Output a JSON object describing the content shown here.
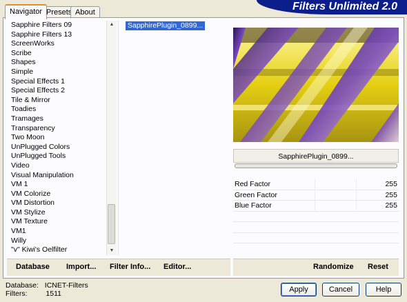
{
  "tabs": [
    "Navigator",
    "Presets",
    "About"
  ],
  "banner": "Filters Unlimited 2.0",
  "categories": [
    "Sapphire Filters 09",
    "Sapphire Filters 13",
    "ScreenWorks",
    "Scribe",
    "Shapes",
    "Simple",
    "Special Effects 1",
    "Special Effects 2",
    "Tile & Mirror",
    "Toadies",
    "Tramages",
    "Transparency",
    "Two Moon",
    "UnPlugged Colors",
    "UnPlugged Tools",
    "Video",
    "Visual Manipulation",
    "VM 1",
    "VM Colorize",
    "VM Distortion",
    "VM Stylize",
    "VM Texture",
    "VM1",
    "Willy",
    "\"v\" Kiwi's Oelfilter"
  ],
  "filters": [
    "SapphirePlugin_0899..."
  ],
  "selected_filter": "SapphirePlugin_0899...",
  "params": [
    {
      "label": "Red Factor",
      "value": "255"
    },
    {
      "label": "Green Factor",
      "value": "255"
    },
    {
      "label": "Blue Factor",
      "value": "255"
    }
  ],
  "left_buttons": {
    "database": "Database",
    "import": "Import...",
    "filter_info": "Filter Info...",
    "editor": "Editor..."
  },
  "right_buttons": {
    "randomize": "Randomize",
    "reset": "Reset"
  },
  "info": {
    "database_label": "Database:",
    "database_value": "ICNET-Filters",
    "filters_label": "Filters:",
    "filters_value": "1511"
  },
  "dialog": {
    "apply": "Apply",
    "cancel": "Cancel",
    "help": "Help"
  },
  "colors": {
    "selection": "#3168d5",
    "banner": "#0c1e8c",
    "preview_yellow": "#e6d52a",
    "preview_purple": "#5a2a8c"
  }
}
